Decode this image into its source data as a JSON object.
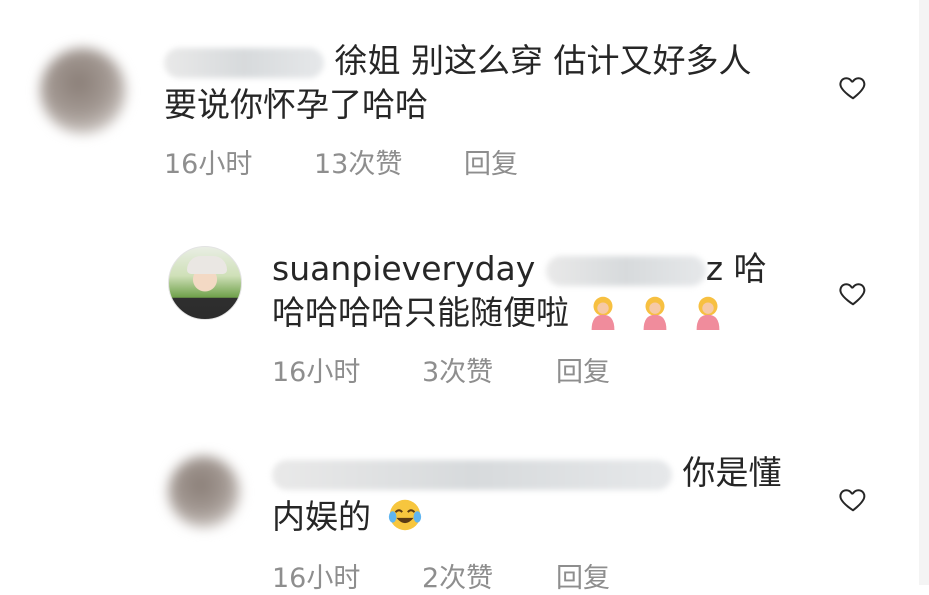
{
  "comments": [
    {
      "text_line1": "徐姐 别这么穿 估计又好多人",
      "text_line2": "要说你怀孕了哈哈",
      "time": "16小时",
      "likes": "13次赞",
      "reply": "回复"
    },
    {
      "username": "suanpieveryday",
      "mention_tail": "z 哈",
      "text_line2": "哈哈哈哈只能随便啦",
      "emoji": [
        "woman-tipping-hand-emoji",
        "woman-tipping-hand-emoji",
        "woman-tipping-hand-emoji"
      ],
      "time": "16小时",
      "likes": "3次赞",
      "reply": "回复"
    },
    {
      "text_line1": "你是懂",
      "text_line2": "内娱的",
      "emoji": [
        "face-with-tears-of-joy-emoji"
      ],
      "time": "16小时",
      "likes": "2次赞",
      "reply": "回复"
    }
  ],
  "colors": {
    "text": "#262626",
    "meta": "#8e8e8e",
    "background": "#ffffff"
  }
}
